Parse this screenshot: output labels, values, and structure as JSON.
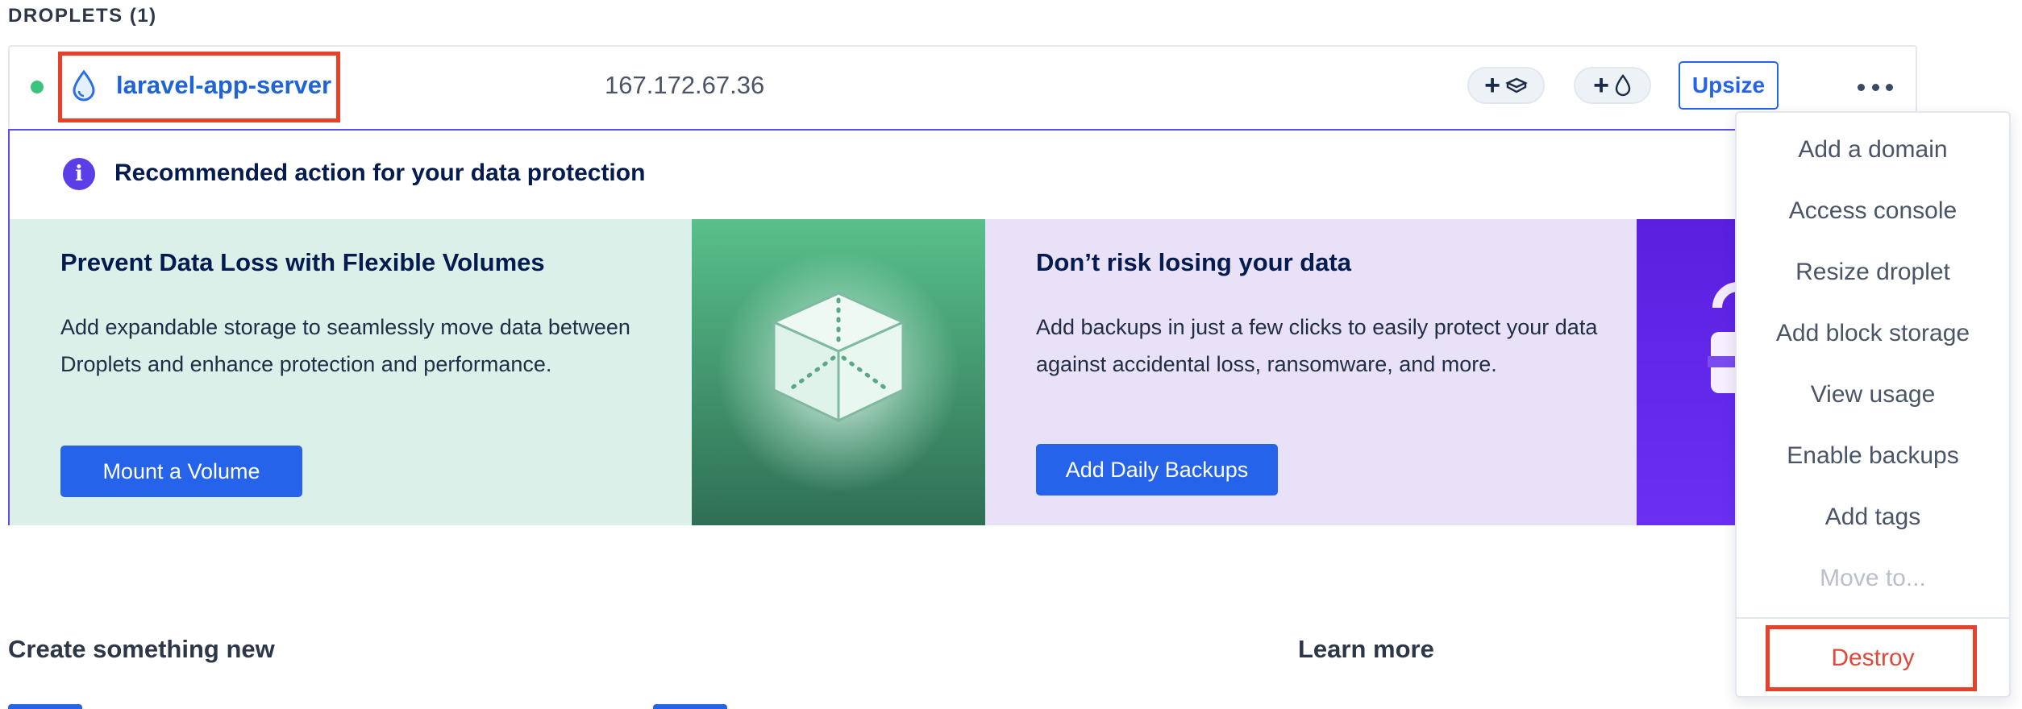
{
  "section": {
    "title": "DROPLETS (1)"
  },
  "droplet": {
    "name": "laravel-app-server",
    "ip": "167.172.67.36",
    "status": "active",
    "chips": [
      "+",
      "+"
    ],
    "upsize_label": "Upsize"
  },
  "recommendation": {
    "title": "Recommended action for your data protection",
    "info_glyph": "i",
    "cards": [
      {
        "heading": "Prevent Data Loss with Flexible Volumes",
        "body": "Add expandable storage to seamlessly move data between Droplets and enhance protection and performance.",
        "button": "Mount a Volume"
      },
      {
        "heading": "Don’t risk losing your data",
        "body": "Add backups in just a few clicks to easily protect your data against accidental loss, ransomware, and more.",
        "button": "Add Daily Backups"
      }
    ]
  },
  "menu": {
    "items": [
      "Add a domain",
      "Access console",
      "Resize droplet",
      "Add block storage",
      "View usage",
      "Enable backups",
      "Add tags",
      "Move to..."
    ],
    "destroy": "Destroy"
  },
  "bottom": {
    "create": "Create something new",
    "learn": "Learn more"
  },
  "colors": {
    "link": "#1f64d6",
    "primary": "#2563eb",
    "status_active": "#3bc47d",
    "highlight": "#e8412a",
    "danger": "#e0483a",
    "volume_card_bg": "#daf0e9",
    "backup_card_bg": "#e8e1f7"
  },
  "icons": [
    "droplet-icon",
    "volume-icon",
    "info-icon",
    "more-options-icon",
    "cube-illustration",
    "lock-illustration"
  ]
}
